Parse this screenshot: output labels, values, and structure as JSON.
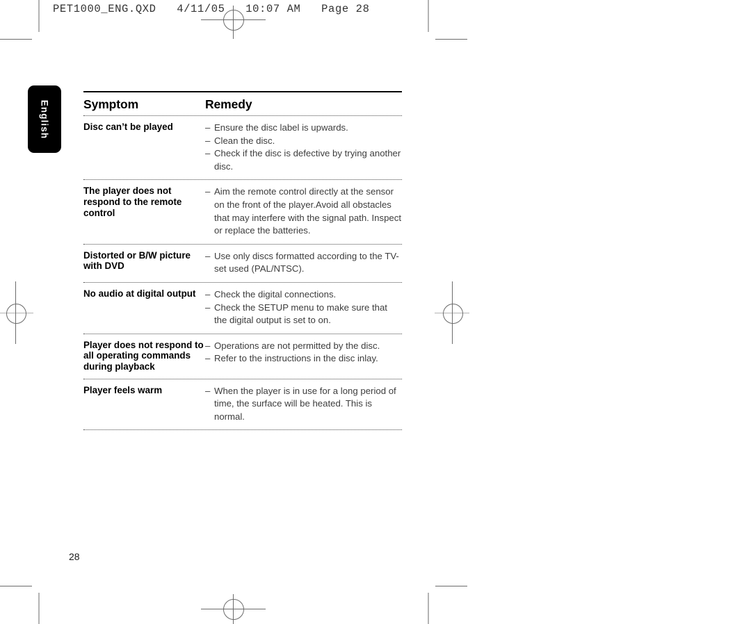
{
  "prepress": {
    "header": "PET1000_ENG.QXD   4/11/05   10:07 AM   Page 28"
  },
  "language_tab": {
    "label": "English"
  },
  "table": {
    "headers": {
      "symptom": "Symptom",
      "remedy": "Remedy"
    },
    "dash": "–",
    "rows": [
      {
        "symptom": "Disc can’t be played",
        "remedies": [
          "Ensure the disc label is upwards.",
          "Clean the disc.",
          "Check if the disc is defective by trying another disc."
        ]
      },
      {
        "symptom": "The player does not respond to the remote control",
        "remedies": [
          "Aim the remote control directly at the sensor on the front of the player.Avoid all obstacles that may interfere with the signal path. Inspect or replace the batteries."
        ]
      },
      {
        "symptom": "Distorted or B/W picture with DVD",
        "remedies": [
          "Use only discs formatted according to the TV-set used (PAL/NTSC)."
        ]
      },
      {
        "symptom": "No audio at digital output",
        "remedies": [
          "Check the digital connections.",
          "Check the SETUP menu to make sure that the digital output is set to on."
        ]
      },
      {
        "symptom": "Player does not respond to all operating commands during playback",
        "remedies": [
          "Operations are not permitted by the disc.",
          "Refer to the instructions in the disc inlay."
        ]
      },
      {
        "symptom": "Player feels warm",
        "remedies": [
          "When the player is in use for a long period of time, the surface will be heated. This is normal."
        ]
      }
    ]
  },
  "footer": {
    "page_number": "28"
  }
}
